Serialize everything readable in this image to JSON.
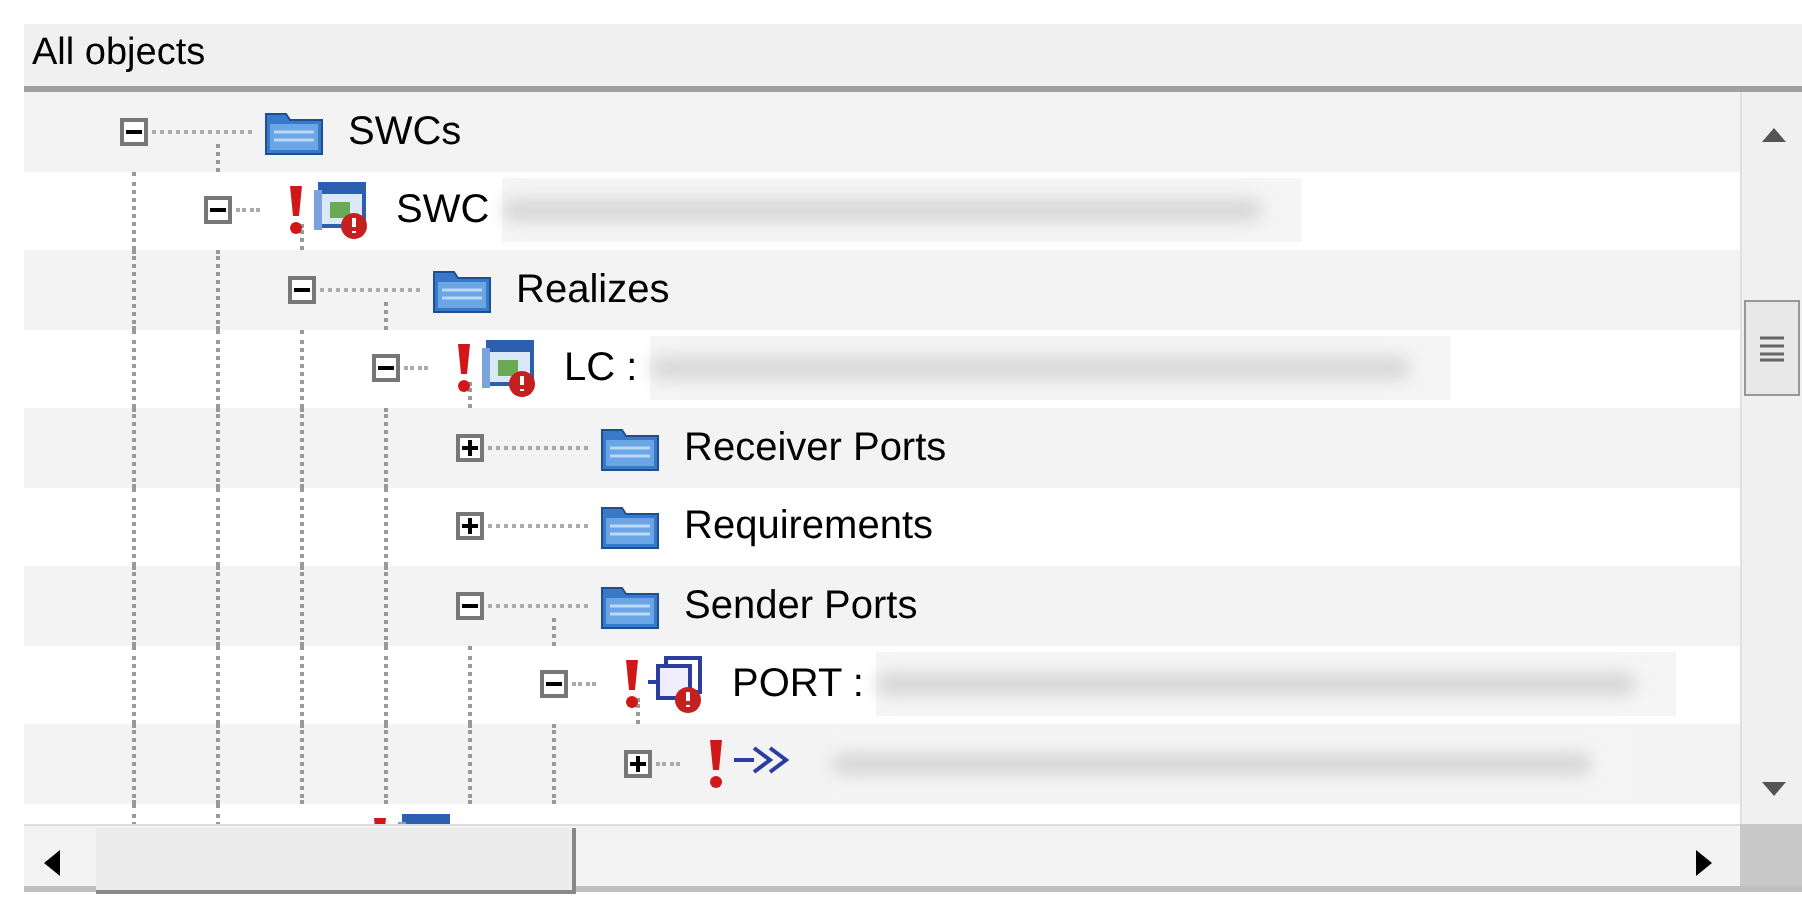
{
  "header": {
    "title": "All objects"
  },
  "tree": [
    {
      "kind": "folder",
      "label": "SWCs",
      "expanded": true,
      "children": [
        {
          "kind": "component",
          "label": "SWC",
          "error": true,
          "blurred": true,
          "expanded": true,
          "children": [
            {
              "kind": "folder",
              "label": "Realizes",
              "expanded": true,
              "children": [
                {
                  "kind": "component",
                  "label": "LC :",
                  "error": true,
                  "blurred": true,
                  "expanded": true,
                  "children": [
                    {
                      "kind": "folder",
                      "label": "Receiver Ports",
                      "expanded": false
                    },
                    {
                      "kind": "folder",
                      "label": "Requirements",
                      "expanded": false
                    },
                    {
                      "kind": "folder",
                      "label": "Sender Ports",
                      "expanded": true,
                      "children": [
                        {
                          "kind": "port",
                          "label": "PORT :",
                          "error": true,
                          "blurred": true,
                          "expanded": true,
                          "children": [
                            {
                              "kind": "element",
                              "error": true,
                              "blurred": true,
                              "expanded": false
                            }
                          ]
                        }
                      ]
                    }
                  ]
                }
              ]
            },
            {
              "kind": "component",
              "error": true
            }
          ]
        }
      ]
    }
  ]
}
